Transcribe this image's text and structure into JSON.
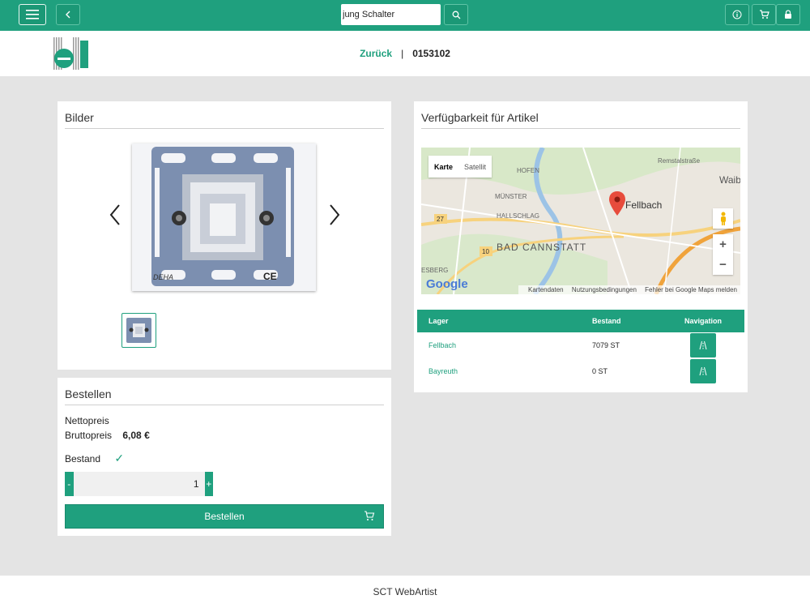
{
  "toolbar": {
    "search_value": "jung Schalter",
    "icons": [
      "menu-icon",
      "back-chevron-icon",
      "search-icon",
      "info-icon",
      "cart-icon",
      "lock-icon"
    ]
  },
  "header": {
    "back_label": "Zurück",
    "separator": "|",
    "article_code": "0153102"
  },
  "bilder": {
    "title": "Bilder"
  },
  "bestellen": {
    "title": "Bestellen",
    "netto_label": "Nettopreis",
    "brutto_label": "Bruttopreis",
    "brutto_value": "6,08 €",
    "bestand_label": "Bestand",
    "bestand_status": "✓",
    "qty_minus": "-",
    "qty_value": "1",
    "qty_plus": "+",
    "order_label": "Bestellen"
  },
  "availability": {
    "title": "Verfügbarkeit für Artikel",
    "map": {
      "tab_map": "Karte",
      "tab_satellite": "Satellit",
      "places": [
        "Fellbach",
        "BAD CANNSTATT",
        "MÜNSTER",
        "HALLSCHLAG",
        "HOFEN",
        "Waib",
        "Remstalstraße",
        "ESBERG",
        "27",
        "10"
      ],
      "google": "Google",
      "footer_data": "Kartendaten",
      "footer_terms": "Nutzungsbedingungen",
      "footer_report": "Fehler bei Google Maps melden",
      "zoom_in": "+",
      "zoom_out": "−"
    },
    "table": {
      "headers": {
        "lager": "Lager",
        "bestand": "Bestand",
        "navigation": "Navigation"
      },
      "rows": [
        {
          "lager": "Fellbach",
          "bestand": "7079 ST"
        },
        {
          "lager": "Bayreuth",
          "bestand": "0 ST"
        }
      ]
    }
  },
  "footer": {
    "text": "SCT WebArtist"
  },
  "colors": {
    "accent": "#1fa07e",
    "background": "#e4e4e4"
  }
}
